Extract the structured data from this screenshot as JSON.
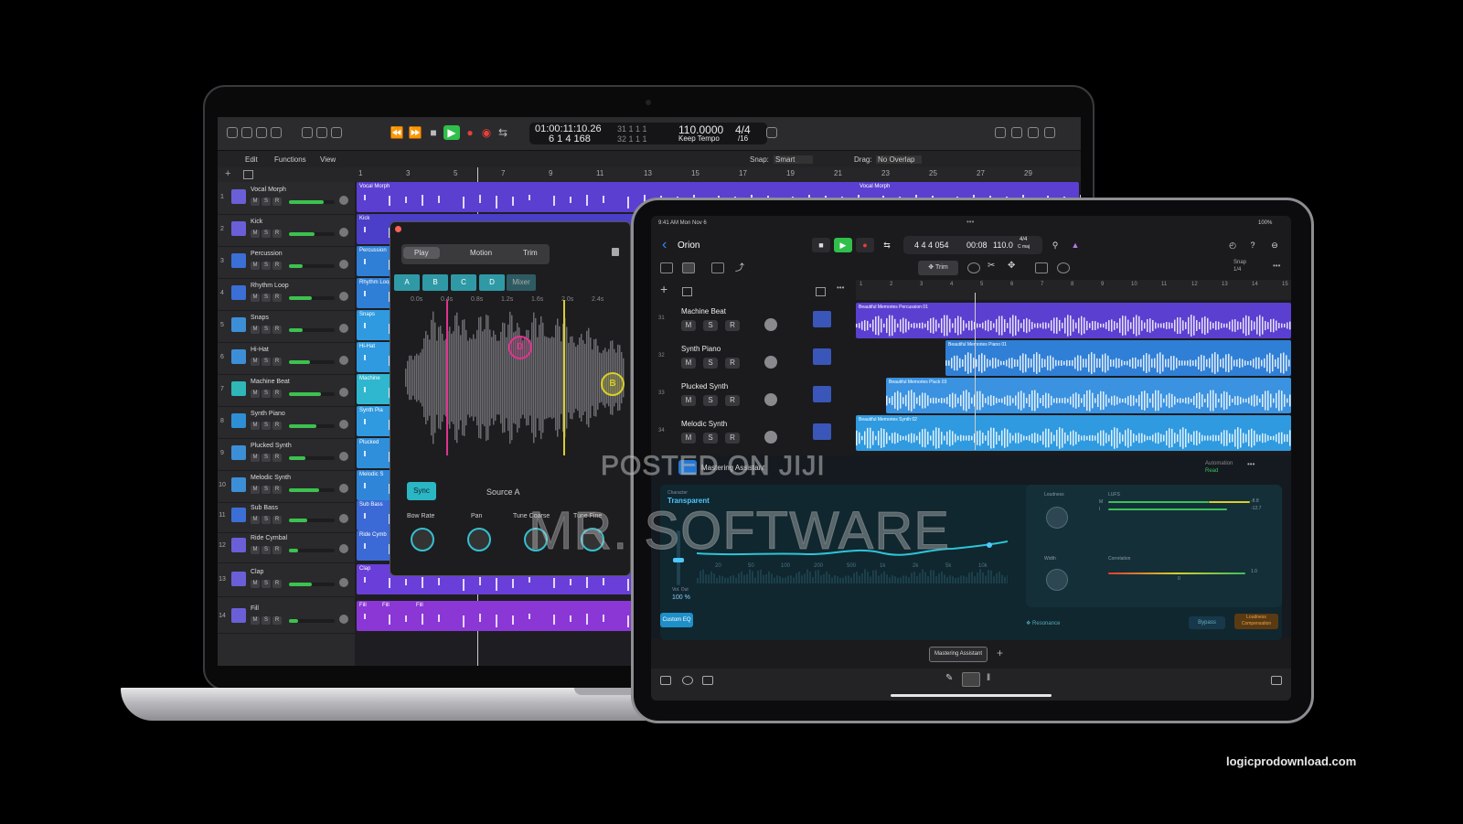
{
  "mac": {
    "lcd": {
      "time": "01:00:11:10.26",
      "bars": "6  1  4  168",
      "sub_top": "31  1  1  1",
      "sub_bottom": "32  1  1  1",
      "tempo": "110.0000",
      "tempo_mode": "Keep Tempo",
      "sig": "4/4",
      "div": "/16"
    },
    "menu": {
      "edit": "Edit",
      "functions": "Functions",
      "view": "View",
      "snap_label": "Snap:",
      "snap_value": "Smart",
      "drag_label": "Drag:",
      "drag_value": "No Overlap"
    },
    "ruler": [
      "1",
      "3",
      "5",
      "7",
      "9",
      "11",
      "13",
      "15",
      "17",
      "19",
      "21",
      "23",
      "25",
      "27",
      "29"
    ],
    "tracks": [
      {
        "num": "1",
        "name": "Vocal Morph",
        "fill": 0.75
      },
      {
        "num": "2",
        "name": "Kick",
        "fill": 0.55
      },
      {
        "num": "3",
        "name": "Percussion",
        "fill": 0.3
      },
      {
        "num": "4",
        "name": "Rhythm Loop",
        "fill": 0.5
      },
      {
        "num": "5",
        "name": "Snaps",
        "fill": 0.3
      },
      {
        "num": "6",
        "name": "Hi-Hat",
        "fill": 0.45
      },
      {
        "num": "7",
        "name": "Machine Beat",
        "fill": 0.7
      },
      {
        "num": "8",
        "name": "Synth Piano",
        "fill": 0.6
      },
      {
        "num": "9",
        "name": "Plucked Synth",
        "fill": 0.35
      },
      {
        "num": "10",
        "name": "Melodic Synth",
        "fill": 0.65
      },
      {
        "num": "11",
        "name": "Sub Bass",
        "fill": 0.4
      },
      {
        "num": "12",
        "name": "Ride Cymbal",
        "fill": 0.2
      },
      {
        "num": "13",
        "name": "Clap",
        "fill": 0.5
      },
      {
        "num": "14",
        "name": "Fill",
        "fill": 0.2
      }
    ],
    "msr": [
      "M",
      "S",
      "R"
    ],
    "regions": [
      "Vocal Morph",
      "Kick",
      "Percussion",
      "Rhythm Loop",
      "Snaps",
      "Hi-Hat",
      "Machine",
      "Synth Pia",
      "Plucked",
      "Melodic S",
      "Sub Bass",
      "Ride Cymb",
      "Clap",
      "Fill"
    ],
    "region_top_right": "Vocal Morph",
    "fill_tags": [
      "Fill",
      "Fill",
      "Fill"
    ],
    "plugin": {
      "tabs": [
        "Play",
        "Motion",
        "Trim"
      ],
      "zones": [
        "A",
        "B",
        "C",
        "D"
      ],
      "mixer": "Mixer",
      "times": [
        "0.0s",
        "0.4s",
        "0.8s",
        "1.2s",
        "1.6s",
        "2.0s",
        "2.4s"
      ],
      "markers": [
        "D",
        "B"
      ],
      "sync": "Sync",
      "source": "Source A",
      "knobs": [
        "Bow Rate",
        "Pan",
        "Tune Coarse",
        "Tune Fine"
      ]
    }
  },
  "ipad": {
    "status_time": "9:41 AM   Mon Nov 6",
    "status_batt": "100%",
    "project": "Orion",
    "lcd": {
      "bars": "4  4  4 054",
      "time": "00:08",
      "tempo": "110.0",
      "sig": "4/4",
      "key": "C maj"
    },
    "trim": "Trim",
    "snap": "Snap",
    "snap_val": "1/4",
    "ruler": [
      "1",
      "2",
      "3",
      "4",
      "5",
      "6",
      "7",
      "8",
      "9",
      "10",
      "11",
      "12",
      "13",
      "14",
      "15"
    ],
    "tracks": [
      {
        "num": "31",
        "name": "Machine Beat"
      },
      {
        "num": "32",
        "name": "Synth Piano"
      },
      {
        "num": "33",
        "name": "Plucked Synth"
      },
      {
        "num": "34",
        "name": "Melodic Synth"
      }
    ],
    "msr": [
      "M",
      "S",
      "R"
    ],
    "regions": [
      "Beautiful Memories Percussion 01",
      "Beautiful Memories Piano 01",
      "Beautiful Memories Pluck 03",
      "Beautiful Memories Synth 02"
    ],
    "mastering": {
      "title": "Mastering Assistant",
      "automation": "Automation",
      "automation_val": "Read",
      "character_label": "Character",
      "character": "Transparent",
      "eq_freqs": [
        "20",
        "50",
        "100",
        "200",
        "500",
        "1k",
        "2k",
        "5k",
        "10k"
      ],
      "volume_label": "Vol. Out",
      "volume": "100 %",
      "custom_eq": "Custom EQ",
      "loudness": "Loudness",
      "lufs": "LUFS",
      "lufs_m": "M",
      "lufs_i": "I",
      "lufs_m_val": "-8.8",
      "lufs_i_val": "-12.7",
      "width": "Width",
      "correlation": "Correlation",
      "corr_val": "1.0",
      "corr_zero": "0",
      "resonance": "Resonance",
      "bypass": "Bypass",
      "loudness_comp": "Loudness Compensation"
    },
    "tab": "Mastering Assistant"
  },
  "watermark": {
    "line1": "POSTED ON JIJI",
    "line2": "MR. SOFTWARE"
  },
  "site": "logicprodownload.com"
}
